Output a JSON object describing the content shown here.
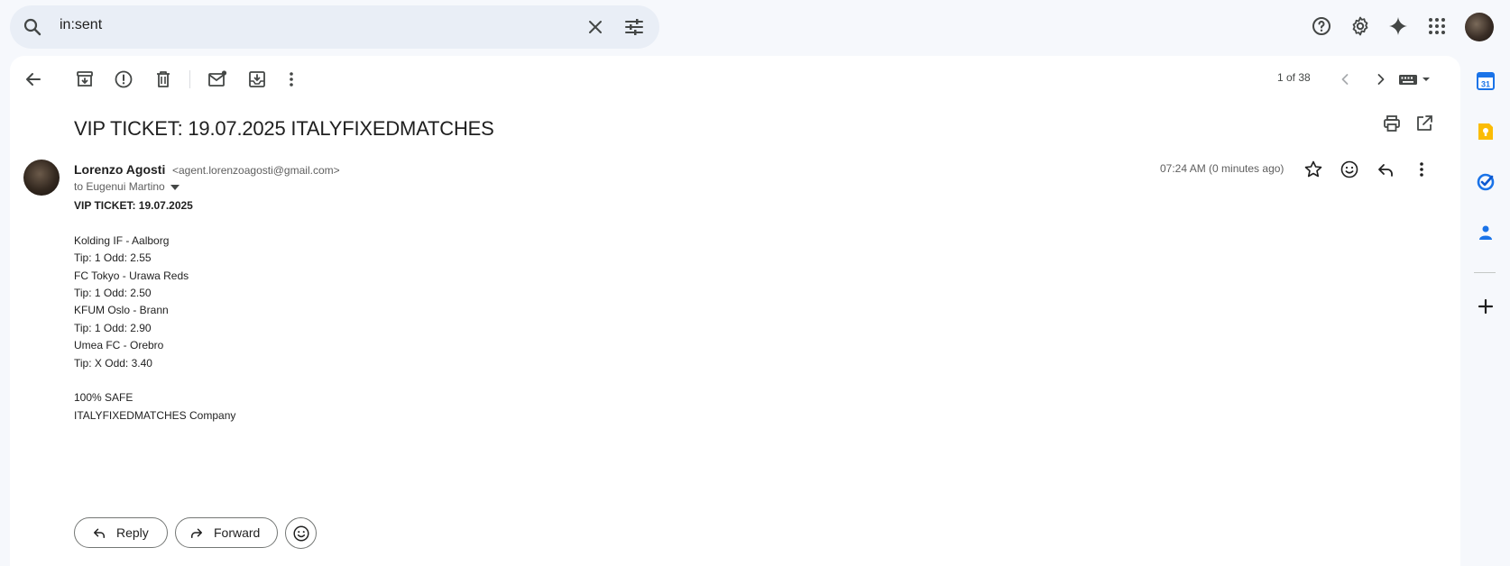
{
  "search": {
    "query": "in:sent",
    "icon": "search-icon",
    "clear_icon": "close-icon",
    "options_icon": "tune-icon"
  },
  "top_right": {
    "icons": [
      "help-icon",
      "settings-icon",
      "gemini-sparkle-icon",
      "apps-grid-icon"
    ],
    "account_avatar": "account-avatar"
  },
  "toolbar": {
    "icons": [
      "back-arrow-icon",
      "archive-icon",
      "report-spam-icon",
      "delete-icon",
      "mark-unread-icon",
      "move-to-icon",
      "more-vert-icon"
    ],
    "pager": "1 of 38",
    "nav_icons": [
      "chevron-left-icon",
      "chevron-right-icon",
      "keyboard-icon"
    ]
  },
  "email": {
    "subject": "VIP TICKET: 19.07.2025 ITALYFIXEDMATCHES",
    "sender_name": "Lorenzo Agosti",
    "sender_email": "<agent.lorenzoagosti@gmail.com>",
    "recipient": "to Eugenui Martino",
    "timestamp": "07:24 AM (0 minutes ago)",
    "body": {
      "heading": "VIP TICKET: 19.07.2025",
      "lines": [
        "Kolding IF - Aalborg",
        "Tip: 1 Odd: 2.55",
        "FC Tokyo - Urawa Reds",
        "Tip: 1 Odd: 2.50",
        "KFUM Oslo - Brann",
        "Tip: 1 Odd: 2.90",
        "Umea FC - Orebro",
        "Tip: X Odd: 3.40"
      ],
      "footer1": "100% SAFE",
      "footer2": "ITALYFIXEDMATCHES Company"
    }
  },
  "actions": {
    "reply_label": "Reply",
    "forward_label": "Forward"
  },
  "side_panel": {
    "icons": [
      "calendar-icon",
      "keep-icon",
      "tasks-icon",
      "contacts-icon",
      "add-icon"
    ],
    "calendar_day": "31"
  },
  "colors": {
    "background": "#f6f8fc",
    "search_bg": "#e9eef6",
    "calendar_blue": "#1a73e8",
    "keep_yellow": "#fbbc04",
    "tasks_blue": "#0b57d0"
  }
}
